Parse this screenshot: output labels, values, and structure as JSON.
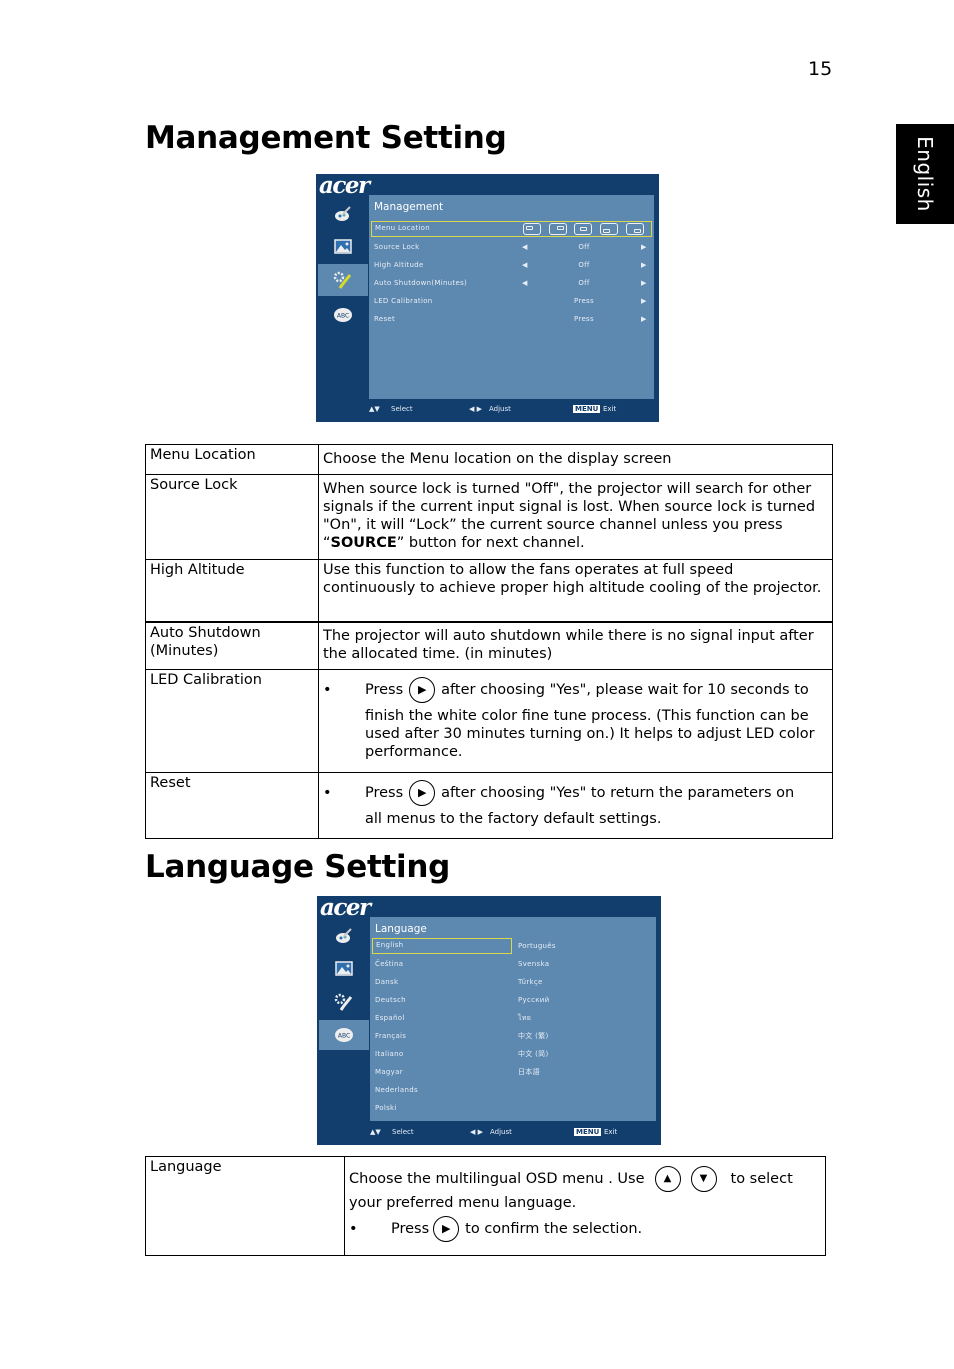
{
  "page": {
    "number": "15",
    "language_tab": "English"
  },
  "management": {
    "title": "Management Setting",
    "osd": {
      "logo": "acer",
      "panel_title": "Management",
      "rows": [
        {
          "label": "Menu Location",
          "value": "",
          "selected": true
        },
        {
          "label": "Source Lock",
          "value": "Off"
        },
        {
          "label": "High Altitude",
          "value": "Off"
        },
        {
          "label": "Auto Shutdown(Minutes)",
          "value": "Off"
        },
        {
          "label": "LED Calibration",
          "value": "Press"
        },
        {
          "label": "Reset",
          "value": "Press"
        }
      ],
      "footer": {
        "select": "Select",
        "adjust": "Adjust",
        "menu": "MENU",
        "exit": "Exit"
      },
      "sidebar_icons": [
        "color-settings-icon",
        "image-icon",
        "management-icon",
        "language-icon"
      ],
      "active_icon": 2
    },
    "table": [
      {
        "key": "Menu Location",
        "desc": "Choose the Menu location on the display screen"
      },
      {
        "key": "Source Lock",
        "desc_pre": "When source lock is turned \"Off\", the projector will search for other signals if the current input signal is lost. When source lock is turned \"On\", it will “Lock” the current source channel unless you press “",
        "desc_strong": "SOURCE",
        "desc_post": "” button for next channel."
      },
      {
        "key": "High Altitude",
        "desc": "Use this function to allow the fans operates at full speed continuously to achieve proper high altitude cooling of the projector."
      },
      {
        "key": "Auto Shutdown (Minutes)",
        "desc": "The projector will auto shutdown while there is no signal input after the allocated time. (in minutes)"
      },
      {
        "key": "LED Calibration",
        "bullet_press": "Press",
        "bullet_after": "after choosing \"Yes\", please wait for 10 seconds to",
        "bullet_cont": "finish the white color fine tune process. (This function can be used after 30 minutes turning on.) It helps to adjust LED color performance."
      },
      {
        "key": "Reset",
        "bullet_press": "Press",
        "bullet_after": "after choosing \"Yes\" to return the parameters on",
        "bullet_cont": "all menus to the factory default settings."
      }
    ]
  },
  "language": {
    "title": "Language Setting",
    "osd": {
      "logo": "acer",
      "panel_title": "Language",
      "left_column": [
        "English",
        "Čeština",
        "Dansk",
        "Deutsch",
        "Español",
        "Français",
        "Italiano",
        "Magyar",
        "Nederlands",
        "Polski"
      ],
      "right_column": [
        "Português",
        "Svenska",
        "Türkçe",
        "Русский",
        "ไทย",
        "中文 (繁)",
        "中文 (简)",
        "日本語"
      ],
      "selected": "English",
      "footer": {
        "select": "Select",
        "adjust": "Adjust",
        "menu": "MENU",
        "exit": "Exit"
      },
      "active_icon": 3
    },
    "table": {
      "key": "Language",
      "line1_pre": "Choose the multilingual OSD menu . Use",
      "line1_post": "to select",
      "line2": "your preferred menu language.",
      "bullet_press": "Press",
      "bullet_after": "to confirm the selection."
    }
  }
}
